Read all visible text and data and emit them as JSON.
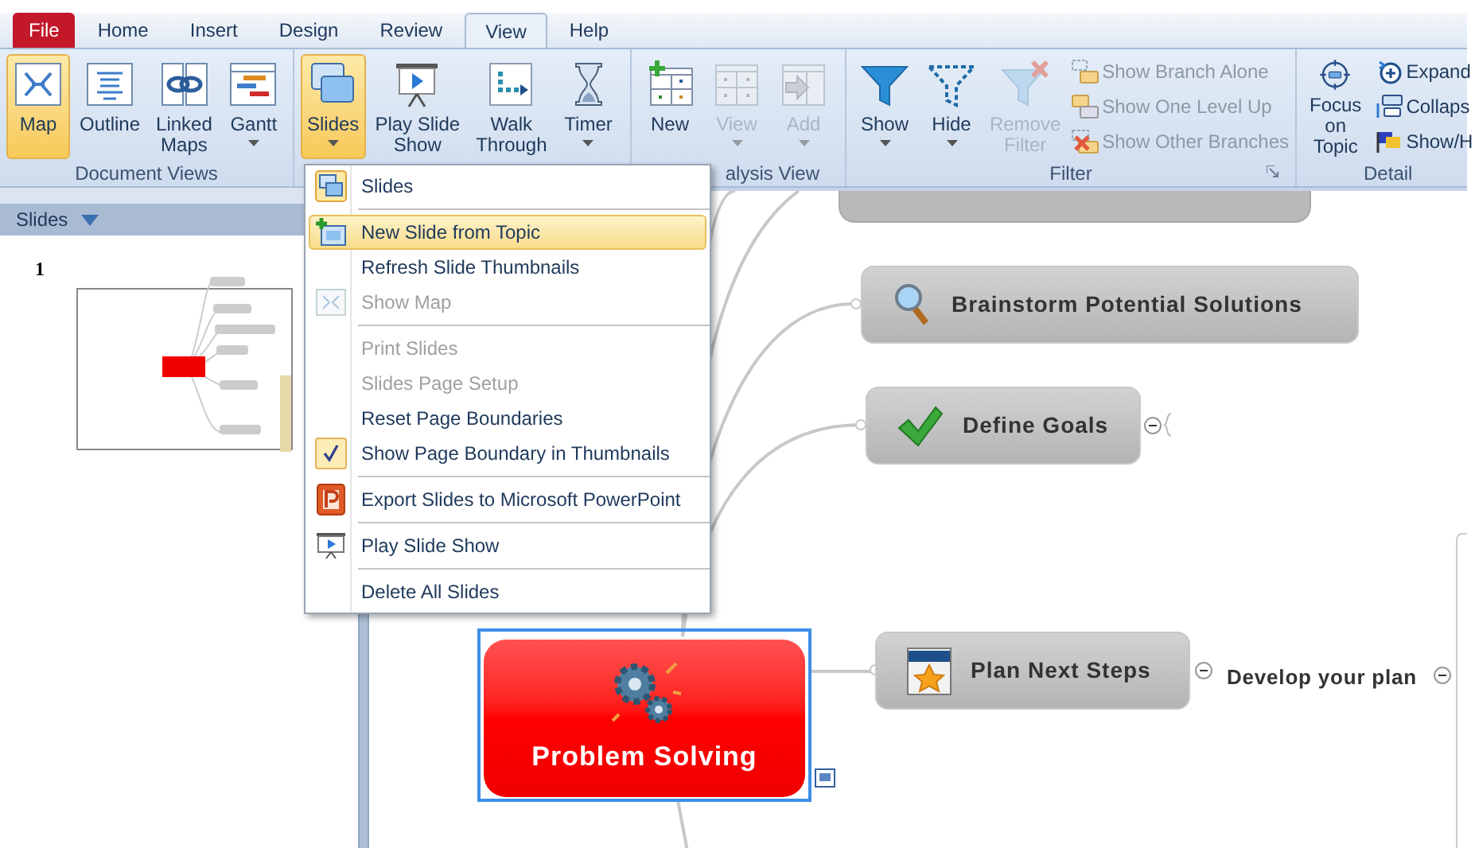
{
  "tabs": [
    {
      "label": "File",
      "kind": "file",
      "selected": false
    },
    {
      "label": "Home",
      "kind": "tab",
      "selected": false
    },
    {
      "label": "Insert",
      "kind": "tab",
      "selected": false
    },
    {
      "label": "Design",
      "kind": "tab",
      "selected": false
    },
    {
      "label": "Review",
      "kind": "tab",
      "selected": false
    },
    {
      "label": "View",
      "kind": "tab",
      "selected": true
    },
    {
      "label": "Help",
      "kind": "tab",
      "selected": false
    }
  ],
  "ribbon": {
    "groups": [
      {
        "label": "Document Views",
        "buttons": [
          {
            "label": "Map",
            "selected": true,
            "disabled": false,
            "dropdown": false
          },
          {
            "label": "Outline",
            "selected": false,
            "disabled": false,
            "dropdown": false
          },
          {
            "label": "Linked\nMaps",
            "selected": false,
            "disabled": false,
            "dropdown": false
          },
          {
            "label": "Gantt",
            "selected": false,
            "disabled": false,
            "dropdown": true
          }
        ]
      },
      {
        "buttons": [
          {
            "label": "Slides",
            "selected": true,
            "disabled": false,
            "dropdown": true
          },
          {
            "label": "Play Slide\nShow",
            "selected": false,
            "disabled": false,
            "dropdown": false
          },
          {
            "label": "Walk\nThrough",
            "selected": false,
            "disabled": false,
            "dropdown": false
          },
          {
            "label": "Timer",
            "selected": false,
            "disabled": false,
            "dropdown": true
          }
        ]
      },
      {
        "label": "alysis View",
        "buttons": [
          {
            "label": "New",
            "selected": false,
            "disabled": false,
            "dropdown": false
          },
          {
            "label": "View",
            "selected": false,
            "disabled": true,
            "dropdown": true
          },
          {
            "label": "Add",
            "selected": false,
            "disabled": true,
            "dropdown": true
          }
        ]
      },
      {
        "label": "Filter",
        "buttons": [
          {
            "label": "Show",
            "selected": false,
            "disabled": false,
            "dropdown": true
          },
          {
            "label": "Hide",
            "selected": false,
            "disabled": false,
            "dropdown": true
          },
          {
            "label": "Remove\nFilter",
            "selected": false,
            "disabled": true,
            "dropdown": false
          }
        ],
        "small_buttons": [
          {
            "label": "Show Branch Alone",
            "disabled": true
          },
          {
            "label": "Show One Level Up",
            "disabled": true
          },
          {
            "label": "Show Other Branches",
            "disabled": true
          }
        ]
      },
      {
        "label": "Detail",
        "buttons": [
          {
            "label": "Focus\non Topic",
            "selected": false,
            "disabled": false,
            "dropdown": false
          }
        ],
        "small_buttons": [
          {
            "label": "Expand",
            "disabled": false
          },
          {
            "label": "Collaps",
            "disabled": false
          },
          {
            "label": "Show/H",
            "disabled": false
          }
        ]
      }
    ]
  },
  "slides_pane": {
    "title": "Slides",
    "slides": [
      {
        "number": "1",
        "selected": false
      }
    ]
  },
  "menu": {
    "items": [
      {
        "label": "Slides",
        "selected": false,
        "disabled": false,
        "checked": false,
        "separator_after": true
      },
      {
        "label": "New Slide from Topic",
        "selected": true,
        "disabled": false,
        "checked": false,
        "separator_after": false
      },
      {
        "label": "Refresh Slide Thumbnails",
        "selected": false,
        "disabled": false,
        "checked": false,
        "separator_after": false
      },
      {
        "label": "Show Map",
        "selected": false,
        "disabled": true,
        "checked": false,
        "separator_after": true
      },
      {
        "label": "Print Slides",
        "selected": false,
        "disabled": true,
        "checked": false,
        "separator_after": false
      },
      {
        "label": "Slides Page Setup",
        "selected": false,
        "disabled": true,
        "checked": false,
        "separator_after": false
      },
      {
        "label": "Reset Page Boundaries",
        "selected": false,
        "disabled": false,
        "checked": false,
        "separator_after": false
      },
      {
        "label": "Show Page Boundary in Thumbnails",
        "selected": false,
        "disabled": false,
        "checked": true,
        "separator_after": true
      },
      {
        "label": "Export Slides to Microsoft PowerPoint",
        "selected": false,
        "disabled": false,
        "checked": false,
        "separator_after": true
      },
      {
        "label": "Play Slide Show",
        "selected": false,
        "disabled": false,
        "checked": false,
        "separator_after": true
      },
      {
        "label": "Delete All Slides",
        "selected": false,
        "disabled": false,
        "checked": false,
        "separator_after": false
      }
    ]
  },
  "map": {
    "central_topic": {
      "label": "Problem Solving",
      "selected": true
    },
    "topics": [
      {
        "label": "Brainstorm Potential Solutions",
        "collapsible": false
      },
      {
        "label": "Define Goals",
        "collapsible": true
      },
      {
        "label": "Plan Next Steps",
        "collapsible": true
      }
    ],
    "subtopic": {
      "label": "Develop your plan",
      "collapsible": true
    }
  }
}
